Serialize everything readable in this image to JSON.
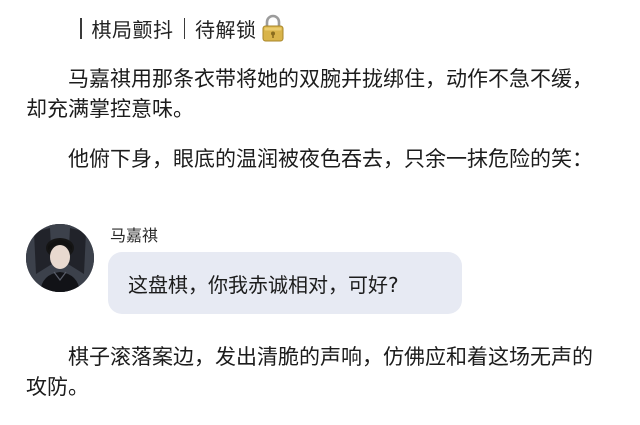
{
  "header": {
    "part1": "棋局颤抖",
    "part2": "待解锁",
    "lock_icon": "padlock-icon"
  },
  "paragraphs": [
    "马嘉祺用那条衣带将她的双腕并拢绑住，动作不急不缓，却充满掌控意味。",
    "他俯下身，眼底的温润被夜色吞去，只余一抹危险的笑：",
    "棋子滚落案边，发出清脆的声响，仿佛应和着这场无声的攻防。"
  ],
  "chat": {
    "sender_name": "马嘉祺",
    "avatar_icon": "avatar-icon",
    "message": "这盘棋，你我赤诚相对，可好?"
  },
  "colors": {
    "bubble_bg": "#e7eaf3",
    "text": "#1c1c1c"
  }
}
